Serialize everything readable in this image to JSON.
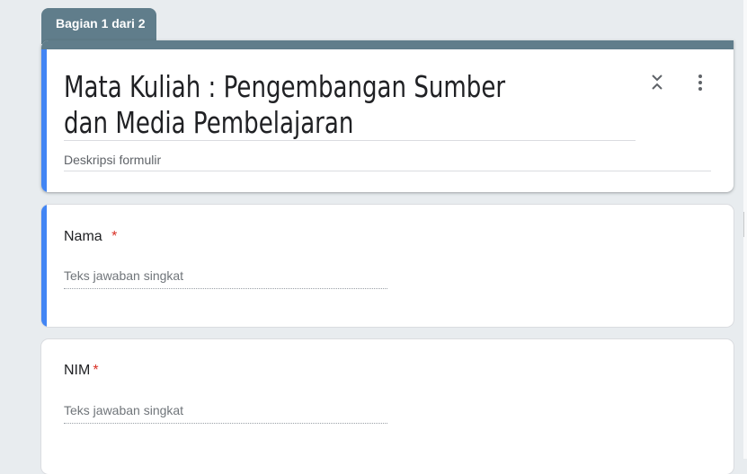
{
  "section_tab": {
    "label": "Bagian 1 dari 2"
  },
  "header": {
    "title": "Mata Kuliah : Pengembangan Sumber dan Media Pembelajaran",
    "description_placeholder": "Deskripsi formulir"
  },
  "questions": [
    {
      "title": "Nama",
      "required_mark": "*",
      "answer_placeholder": "Teks jawaban singkat"
    },
    {
      "title": "NIM",
      "required_mark": "*",
      "answer_placeholder": "Teks jawaban singkat"
    }
  ],
  "icons": {
    "collapse": "collapse-icon",
    "more": "more-vert-icon"
  },
  "colors": {
    "background": "#e8ecef",
    "section_header": "#607d8b",
    "accent": "#4285f4",
    "required": "#d93025"
  }
}
